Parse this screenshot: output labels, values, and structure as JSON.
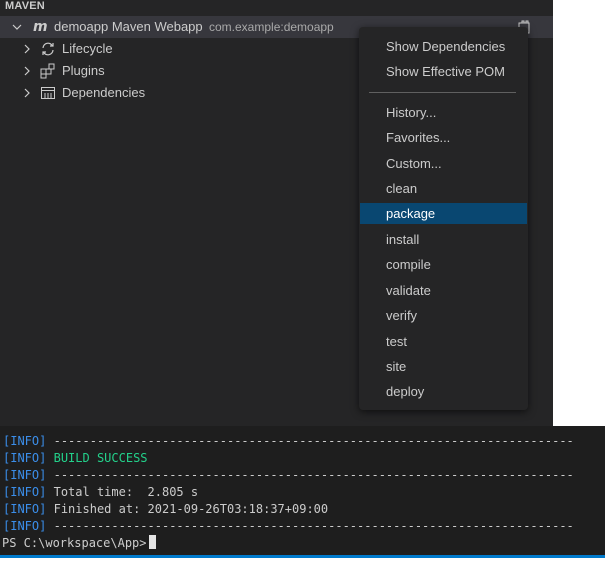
{
  "panel": {
    "header": "MAVEN",
    "project": {
      "name": "demoapp Maven Webapp",
      "artifact": "com.example:demoapp",
      "logo": "m"
    },
    "children": [
      {
        "label": "Lifecycle",
        "icon": "sync-icon"
      },
      {
        "label": "Plugins",
        "icon": "extensions-icon"
      },
      {
        "label": "Dependencies",
        "icon": "library-icon"
      }
    ]
  },
  "context_menu": {
    "group1": [
      "Show Dependencies",
      "Show Effective POM"
    ],
    "group2": [
      "History...",
      "Favorites...",
      "Custom...",
      "clean",
      "package",
      "install",
      "compile",
      "validate",
      "verify",
      "test",
      "site",
      "deploy"
    ],
    "active": "package"
  },
  "terminal": {
    "tag": "[INFO]",
    "dashes": "------------------------------------------------------------------------",
    "build_status": "BUILD SUCCESS",
    "total_time": "Total time:  2.805 s",
    "finished_at": "Finished at: 2021-09-26T03:18:37+09:00",
    "prompt": "PS C:\\workspace\\App>"
  },
  "colors": {
    "accent": "#007acc",
    "selection": "#094771",
    "info_tag": "#3b8eea",
    "success": "#23d18b"
  }
}
